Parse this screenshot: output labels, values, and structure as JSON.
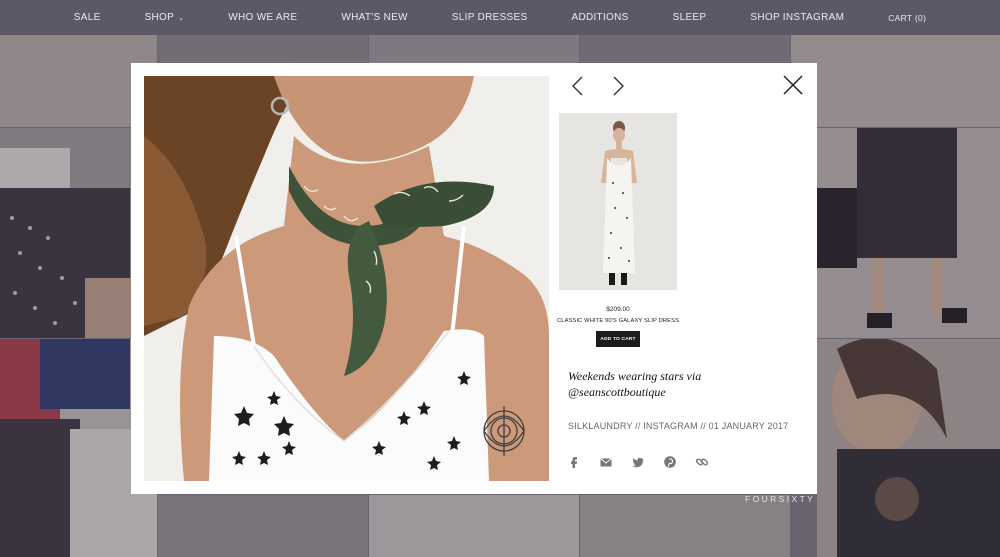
{
  "nav": {
    "links": [
      {
        "label": "SALE"
      },
      {
        "label": "SHOP",
        "has_dropdown": true
      },
      {
        "label": "WHO WE ARE"
      },
      {
        "label": "WHAT'S NEW"
      },
      {
        "label": "SLIP DRESSES"
      },
      {
        "label": "ADDITIONS"
      },
      {
        "label": "SLEEP"
      },
      {
        "label": "SHOP INSTAGRAM"
      }
    ],
    "cart_label": "CART (0)"
  },
  "modal": {
    "product": {
      "price": "$209.00",
      "name": "CLASSIC WHITE 90'S GALAXY SLIP DRESS",
      "add_to_cart": "ADD TO CART"
    },
    "caption_line1": "Weekends wearing stars via",
    "caption_line2": "@seanscottboutique",
    "meta": "SILKLAUNDRY // INSTAGRAM // 01 JANUARY 2017",
    "share_icons": [
      "facebook-icon",
      "email-icon",
      "twitter-icon",
      "pinterest-icon",
      "link-icon"
    ]
  },
  "watermark": "FOURSIXTY",
  "colors": {
    "nav_bg": "#5d5866",
    "overlay": "#6b6470",
    "modal_bg": "#ffffff",
    "button_bg": "#1c1c1c",
    "scarf": "#3d5238"
  }
}
